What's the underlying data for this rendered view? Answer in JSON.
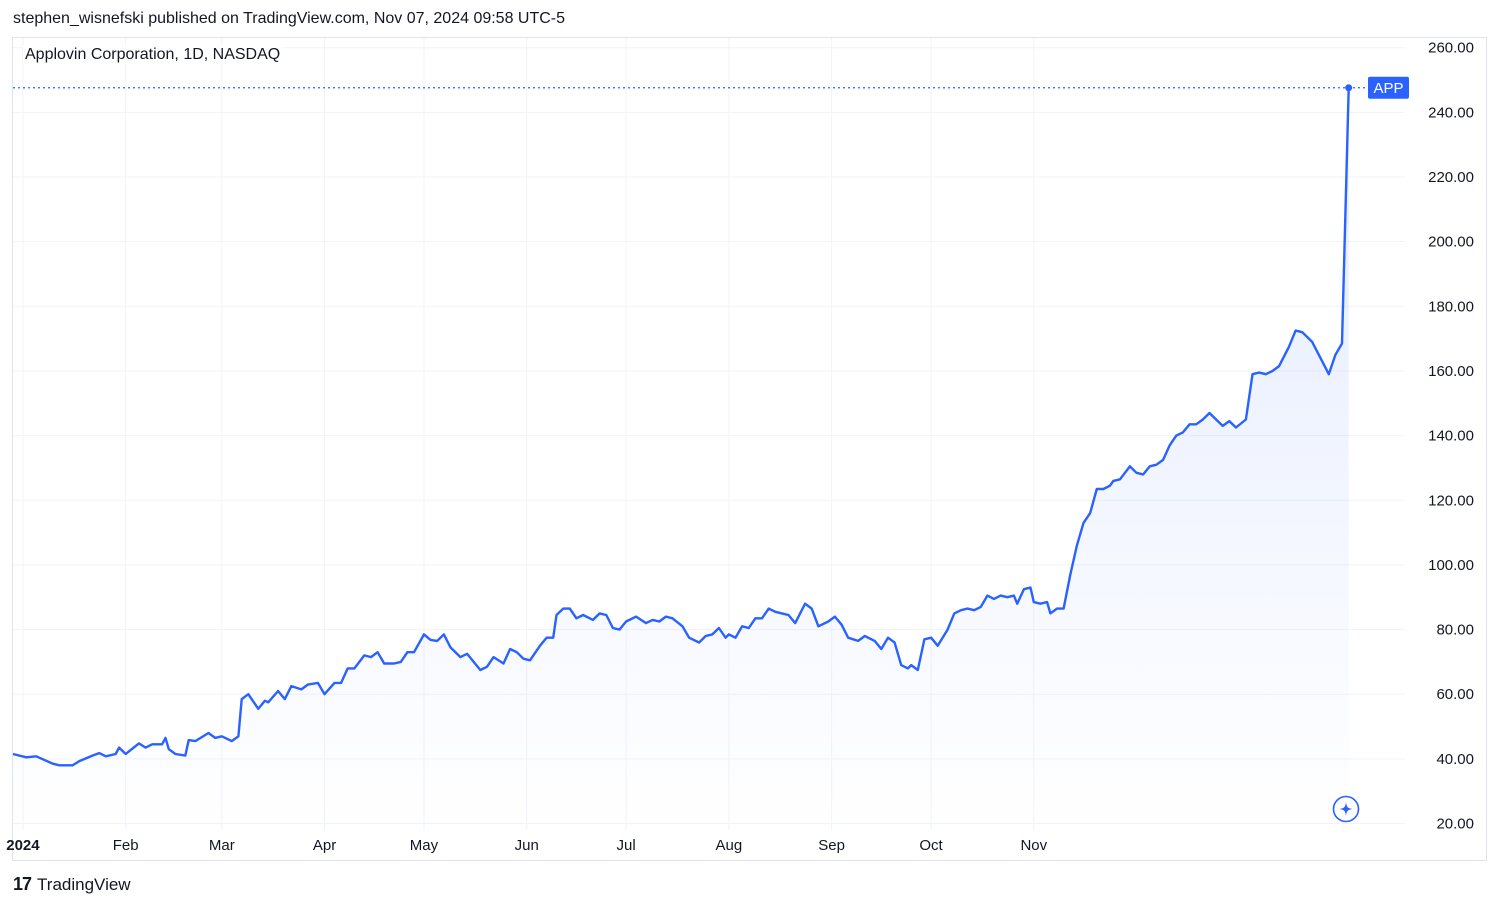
{
  "header": {
    "published": "stephen_wisnefski published on TradingView.com, Nov 07, 2024 09:58 UTC-5"
  },
  "symbol_title": "Applovin Corporation, 1D, NASDAQ",
  "footer": {
    "brand": "TradingView",
    "logo_mark": "17"
  },
  "colors": {
    "line": "#2962ff",
    "grid": "#f0f3fa",
    "text": "#131722",
    "badge_bg": "#2962ff",
    "badge_text": "#ffffff"
  },
  "chart_data": {
    "type": "area",
    "ylim": [
      18,
      263
    ],
    "y_ticks": [
      "260.00",
      "240.00",
      "220.00",
      "200.00",
      "180.00",
      "160.00",
      "140.00",
      "120.00",
      "100.00",
      "80.00",
      "60.00",
      "40.00",
      "20.00"
    ],
    "x_ticks": [
      {
        "label": "2024",
        "date": "2024-01-01"
      },
      {
        "label": "Feb",
        "date": "2024-02-01"
      },
      {
        "label": "Mar",
        "date": "2024-03-01"
      },
      {
        "label": "Apr",
        "date": "2024-04-01"
      },
      {
        "label": "May",
        "date": "2024-05-01"
      },
      {
        "label": "Jun",
        "date": "2024-06-01"
      },
      {
        "label": "Jul",
        "date": "2024-07-01"
      },
      {
        "label": "Aug",
        "date": "2024-08-01"
      },
      {
        "label": "Sep",
        "date": "2024-09-01"
      },
      {
        "label": "Oct",
        "date": "2024-10-01"
      },
      {
        "label": "Nov",
        "date": "2024-11-01"
      }
    ],
    "series": [
      {
        "name": "APP",
        "last_value": 247.6,
        "points": [
          [
            "2023-12-29",
            41.5
          ],
          [
            "2024-01-02",
            40.5
          ],
          [
            "2024-01-05",
            40.8
          ],
          [
            "2024-01-10",
            38.5
          ],
          [
            "2024-01-12",
            38.0
          ],
          [
            "2024-01-16",
            38.0
          ],
          [
            "2024-01-18",
            39.3
          ],
          [
            "2024-01-22",
            41.0
          ],
          [
            "2024-01-24",
            41.8
          ],
          [
            "2024-01-26",
            40.8
          ],
          [
            "2024-01-29",
            41.5
          ],
          [
            "2024-01-30",
            43.5
          ],
          [
            "2024-02-01",
            41.5
          ],
          [
            "2024-02-05",
            44.8
          ],
          [
            "2024-02-07",
            43.5
          ],
          [
            "2024-02-09",
            44.5
          ],
          [
            "2024-02-12",
            44.5
          ],
          [
            "2024-02-13",
            46.5
          ],
          [
            "2024-02-14",
            43.0
          ],
          [
            "2024-02-16",
            41.5
          ],
          [
            "2024-02-19",
            41.0
          ],
          [
            "2024-02-20",
            45.8
          ],
          [
            "2024-02-22",
            45.5
          ],
          [
            "2024-02-26",
            48.0
          ],
          [
            "2024-02-28",
            46.5
          ],
          [
            "2024-03-01",
            47.0
          ],
          [
            "2024-03-04",
            45.5
          ],
          [
            "2024-03-06",
            47.0
          ],
          [
            "2024-03-07",
            58.5
          ],
          [
            "2024-03-09",
            60.0
          ],
          [
            "2024-03-12",
            55.5
          ],
          [
            "2024-03-14",
            58.0
          ],
          [
            "2024-03-15",
            57.5
          ],
          [
            "2024-03-18",
            61.0
          ],
          [
            "2024-03-20",
            58.5
          ],
          [
            "2024-03-22",
            62.5
          ],
          [
            "2024-03-25",
            61.5
          ],
          [
            "2024-03-27",
            63.0
          ],
          [
            "2024-03-30",
            63.5
          ],
          [
            "2024-04-01",
            60.0
          ],
          [
            "2024-04-04",
            63.5
          ],
          [
            "2024-04-06",
            63.5
          ],
          [
            "2024-04-08",
            68.0
          ],
          [
            "2024-04-10",
            68.0
          ],
          [
            "2024-04-13",
            72.0
          ],
          [
            "2024-04-15",
            71.5
          ],
          [
            "2024-04-17",
            73.0
          ],
          [
            "2024-04-19",
            69.5
          ],
          [
            "2024-04-22",
            69.5
          ],
          [
            "2024-04-24",
            70.0
          ],
          [
            "2024-04-26",
            73.0
          ],
          [
            "2024-04-28",
            73.0
          ],
          [
            "2024-05-01",
            78.5
          ],
          [
            "2024-05-03",
            76.8
          ],
          [
            "2024-05-05",
            76.5
          ],
          [
            "2024-05-07",
            78.5
          ],
          [
            "2024-05-09",
            74.5
          ],
          [
            "2024-05-12",
            71.5
          ],
          [
            "2024-05-14",
            72.5
          ],
          [
            "2024-05-18",
            67.5
          ],
          [
            "2024-05-20",
            68.5
          ],
          [
            "2024-05-22",
            71.5
          ],
          [
            "2024-05-25",
            69.5
          ],
          [
            "2024-05-27",
            74.0
          ],
          [
            "2024-05-29",
            73.0
          ],
          [
            "2024-05-31",
            71.0
          ],
          [
            "2024-06-02",
            70.5
          ],
          [
            "2024-06-05",
            75.0
          ],
          [
            "2024-06-07",
            77.5
          ],
          [
            "2024-06-09",
            77.5
          ],
          [
            "2024-06-10",
            84.5
          ],
          [
            "2024-06-12",
            86.5
          ],
          [
            "2024-06-14",
            86.5
          ],
          [
            "2024-06-16",
            83.5
          ],
          [
            "2024-06-18",
            84.5
          ],
          [
            "2024-06-21",
            83.0
          ],
          [
            "2024-06-23",
            85.0
          ],
          [
            "2024-06-25",
            84.5
          ],
          [
            "2024-06-27",
            80.5
          ],
          [
            "2024-06-29",
            80.0
          ],
          [
            "2024-07-01",
            82.5
          ],
          [
            "2024-07-04",
            84.0
          ],
          [
            "2024-07-07",
            82.0
          ],
          [
            "2024-07-09",
            83.0
          ],
          [
            "2024-07-11",
            82.5
          ],
          [
            "2024-07-13",
            84.0
          ],
          [
            "2024-07-15",
            83.5
          ],
          [
            "2024-07-18",
            81.0
          ],
          [
            "2024-07-20",
            77.5
          ],
          [
            "2024-07-23",
            76.0
          ],
          [
            "2024-07-25",
            78.0
          ],
          [
            "2024-07-27",
            78.5
          ],
          [
            "2024-07-29",
            80.5
          ],
          [
            "2024-07-31",
            77.5
          ],
          [
            "2024-08-01",
            78.5
          ],
          [
            "2024-08-03",
            77.5
          ],
          [
            "2024-08-05",
            81.0
          ],
          [
            "2024-08-07",
            80.5
          ],
          [
            "2024-08-09",
            83.5
          ],
          [
            "2024-08-11",
            83.5
          ],
          [
            "2024-08-13",
            86.5
          ],
          [
            "2024-08-15",
            85.5
          ],
          [
            "2024-08-17",
            85.0
          ],
          [
            "2024-08-19",
            84.5
          ],
          [
            "2024-08-21",
            82.0
          ],
          [
            "2024-08-24",
            88.0
          ],
          [
            "2024-08-26",
            86.5
          ],
          [
            "2024-08-28",
            81.0
          ],
          [
            "2024-08-31",
            82.5
          ],
          [
            "2024-09-02",
            84.0
          ],
          [
            "2024-09-04",
            81.5
          ],
          [
            "2024-09-06",
            77.5
          ],
          [
            "2024-09-09",
            76.5
          ],
          [
            "2024-09-11",
            78.0
          ],
          [
            "2024-09-14",
            76.5
          ],
          [
            "2024-09-16",
            74.0
          ],
          [
            "2024-09-18",
            77.5
          ],
          [
            "2024-09-20",
            76.0
          ],
          [
            "2024-09-22",
            69.0
          ],
          [
            "2024-09-24",
            68.0
          ],
          [
            "2024-09-25",
            69.0
          ],
          [
            "2024-09-27",
            67.5
          ],
          [
            "2024-09-29",
            77.0
          ],
          [
            "2024-10-01",
            77.5
          ],
          [
            "2024-10-03",
            75.0
          ],
          [
            "2024-10-06",
            80.0
          ],
          [
            "2024-10-08",
            85.0
          ],
          [
            "2024-10-10",
            86.0
          ],
          [
            "2024-10-12",
            86.5
          ],
          [
            "2024-10-14",
            86.0
          ],
          [
            "2024-10-16",
            87.0
          ],
          [
            "2024-10-18",
            90.5
          ],
          [
            "2024-10-20",
            89.5
          ],
          [
            "2024-10-22",
            90.5
          ],
          [
            "2024-10-24",
            90.0
          ],
          [
            "2024-10-26",
            90.5
          ],
          [
            "2024-10-27",
            88.0
          ],
          [
            "2024-10-29",
            92.5
          ],
          [
            "2024-10-31",
            93.0
          ],
          [
            "2024-11-01",
            88.5
          ],
          [
            "2024-11-03",
            88.0
          ],
          [
            "2024-11-05",
            88.5
          ],
          [
            "2024-11-06",
            85.0
          ],
          [
            "2024-11-08",
            86.5
          ],
          [
            "2024-11-10",
            86.5
          ],
          [
            "2024-11-12",
            97.0
          ],
          [
            "2024-11-14",
            106.0
          ],
          [
            "2024-11-16",
            113.0
          ],
          [
            "2024-11-18",
            116.0
          ],
          [
            "2024-11-20",
            123.5
          ],
          [
            "2024-11-22",
            123.5
          ],
          [
            "2024-11-24",
            124.5
          ],
          [
            "2024-11-25",
            126.0
          ],
          [
            "2024-11-27",
            126.5
          ],
          [
            "2024-11-30",
            130.5
          ],
          [
            "2024-12-02",
            128.5
          ],
          [
            "2024-12-04",
            128.0
          ],
          [
            "2024-12-06",
            130.5
          ],
          [
            "2024-12-08",
            131.0
          ],
          [
            "2024-12-10",
            132.5
          ],
          [
            "2024-12-12",
            137.0
          ],
          [
            "2024-12-14",
            140.0
          ],
          [
            "2024-12-16",
            141.0
          ],
          [
            "2024-12-18",
            143.5
          ],
          [
            "2024-12-20",
            143.5
          ],
          [
            "2024-12-22",
            145.0
          ],
          [
            "2024-12-24",
            147.0
          ],
          [
            "2024-12-26",
            145.0
          ],
          [
            "2024-12-28",
            143.0
          ],
          [
            "2024-12-30",
            144.5
          ],
          [
            "2025-01-01",
            142.5
          ],
          [
            "2025-01-04",
            145.0
          ],
          [
            "2025-01-06",
            159.0
          ],
          [
            "2025-01-08",
            159.5
          ],
          [
            "2025-01-10",
            159.0
          ],
          [
            "2025-01-12",
            160.0
          ],
          [
            "2025-01-14",
            161.5
          ],
          [
            "2025-01-17",
            167.5
          ],
          [
            "2025-01-19",
            172.5
          ],
          [
            "2025-01-21",
            172.0
          ],
          [
            "2025-01-24",
            169.0
          ],
          [
            "2025-01-28",
            161.0
          ],
          [
            "2025-01-29",
            159.0
          ],
          [
            "2025-01-31",
            165.0
          ],
          [
            "2025-02-02",
            168.5
          ],
          [
            "2025-02-04",
            247.6
          ]
        ]
      }
    ]
  }
}
